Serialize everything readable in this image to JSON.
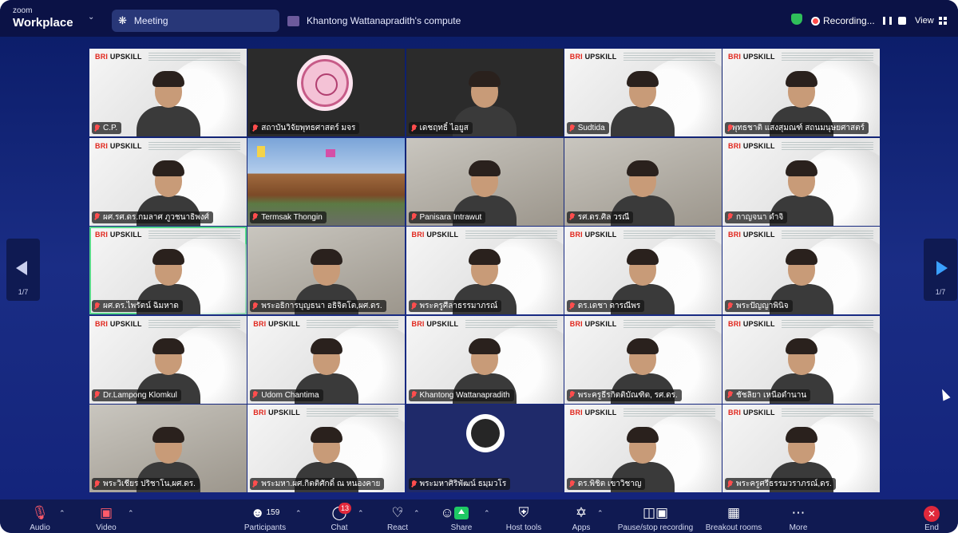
{
  "app": {
    "brand_line1": "zoom",
    "brand_line2": "Workplace"
  },
  "topbar": {
    "meeting_label": "Meeting",
    "share_title": "Khantong Wattanapradith's compute",
    "recording_label": "Recording...",
    "view_label": "View"
  },
  "nav": {
    "left_page": "1/7",
    "right_page": "1/7"
  },
  "tiles": [
    {
      "name": "C.P.",
      "type": "banner",
      "banner": "UPSKILL"
    },
    {
      "name": "สถาบันวิจัยพุทธศาสตร์ มจร",
      "type": "seal"
    },
    {
      "name": "เดชฤทธิ์ ไอยูส",
      "type": "dark-cam"
    },
    {
      "name": "Sudtida",
      "type": "banner",
      "banner": "UPSKILL"
    },
    {
      "name": "พุทธชาติ แสงสุมณฑ์ สถนมนุษยศาสตร์",
      "type": "banner",
      "banner": "UPSKILL"
    },
    {
      "name": "ผศ.รศ.ดร.กมลาศ ภูวชนาธิพงศ์",
      "type": "banner",
      "banner": "UPSKILL"
    },
    {
      "name": "Termsak Thongin",
      "type": "temple"
    },
    {
      "name": "Panisara Intrawut",
      "type": "cam"
    },
    {
      "name": "รศ.ดร.ศิล วรณี",
      "type": "cam"
    },
    {
      "name": "กาญจนา ดำจิ",
      "type": "banner",
      "banner": "UPSKILL"
    },
    {
      "name": "ผศ.ดร.ไพรัตน์ ฉิมหาด",
      "type": "banner",
      "banner": "UPSKILL",
      "active": true
    },
    {
      "name": "พระอธิการบุญธนา อธิจิตโต,ผศ.ดร.",
      "type": "cam"
    },
    {
      "name": "พระครูศีลาธรรมาภรณ์",
      "type": "banner",
      "banner": "UPSKILL"
    },
    {
      "name": "ดร.เดชา ดารณีพร",
      "type": "banner",
      "banner": "UPSKILL"
    },
    {
      "name": "พระปัญญาพินิจ",
      "type": "banner",
      "banner": "UPSKILL"
    },
    {
      "name": "Dr.Lampong Klomkul",
      "type": "banner",
      "banner": "UPSKILL"
    },
    {
      "name": "Udom Chantima",
      "type": "banner",
      "banner": "UPSKILL"
    },
    {
      "name": "Khantong Wattanapradith",
      "type": "banner",
      "banner": "UPSKILL"
    },
    {
      "name": "พระครูธีรกิตติบัณฑิต, รศ.ดร.",
      "type": "banner",
      "banner": "UPSKILL"
    },
    {
      "name": "ชัชลิยา เหนือดำนาน",
      "type": "banner",
      "banner": "UPSKILL"
    },
    {
      "name": "พระวิเชียร ปริชาโน,ผศ.ดร.",
      "type": "cam"
    },
    {
      "name": "พระมหา.ผศ.กิตติศักดิ์ ณ หนองคาย",
      "type": "banner",
      "banner": "UPSKILL"
    },
    {
      "name": "พระมหาศิริพัฒน์ ธมฺมวโร",
      "type": "obs"
    },
    {
      "name": "ดร.พิชิต เขาวิชาญ",
      "type": "banner",
      "banner": "UPSKILL"
    },
    {
      "name": "พระครูศรีธรรมวราภรณ์,ดร.",
      "type": "banner",
      "banner": "UPSKILL"
    }
  ],
  "toolbar": {
    "audio": "Audio",
    "video": "Video",
    "participants": "Participants",
    "participants_count": "159",
    "chat": "Chat",
    "chat_badge": "13",
    "react": "React",
    "share": "Share",
    "host_tools": "Host tools",
    "apps": "Apps",
    "pause_recording": "Pause/stop recording",
    "breakout": "Breakout rooms",
    "more": "More",
    "end": "End"
  },
  "colors": {
    "background": "#13237a",
    "accent_green": "#58d88a",
    "record_red": "#ff4a4a",
    "share_green": "#1ec964",
    "end_red": "#e0283b"
  }
}
